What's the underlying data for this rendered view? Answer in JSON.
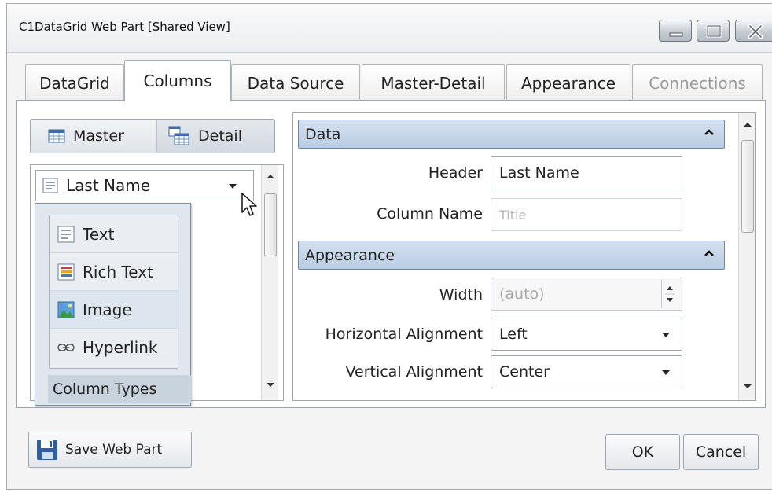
{
  "window": {
    "title": "C1DataGrid Web Part [Shared View]"
  },
  "tabs": [
    {
      "label": "DataGrid"
    },
    {
      "label": "Columns",
      "active": true
    },
    {
      "label": "Data Source"
    },
    {
      "label": "Master-Detail"
    },
    {
      "label": "Appearance"
    },
    {
      "label": "Connections",
      "disabled": true
    }
  ],
  "view_toggle": {
    "master_label": "Master",
    "detail_label": "Detail"
  },
  "column_combo": {
    "value": "Last Name"
  },
  "column_types_popup": {
    "items": [
      {
        "label": "Text"
      },
      {
        "label": "Rich Text"
      },
      {
        "label": "Image"
      },
      {
        "label": "Hyperlink"
      }
    ],
    "footer": "Column Types"
  },
  "properties": {
    "data_section": "Data",
    "header_label": "Header",
    "header_value": "Last Name",
    "column_name_label": "Column Name",
    "column_name_placeholder": "Title",
    "appearance_section": "Appearance",
    "width_label": "Width",
    "width_value": "(auto)",
    "halign_label": "Horizontal Alignment",
    "halign_value": "Left",
    "valign_label": "Vertical Alignment",
    "valign_value": "Center"
  },
  "footer": {
    "save_label": "Save Web Part",
    "ok_label": "OK",
    "cancel_label": "Cancel"
  },
  "colors": {
    "section_header": "#c7d7ea",
    "accent_border": "#6b87a6"
  }
}
